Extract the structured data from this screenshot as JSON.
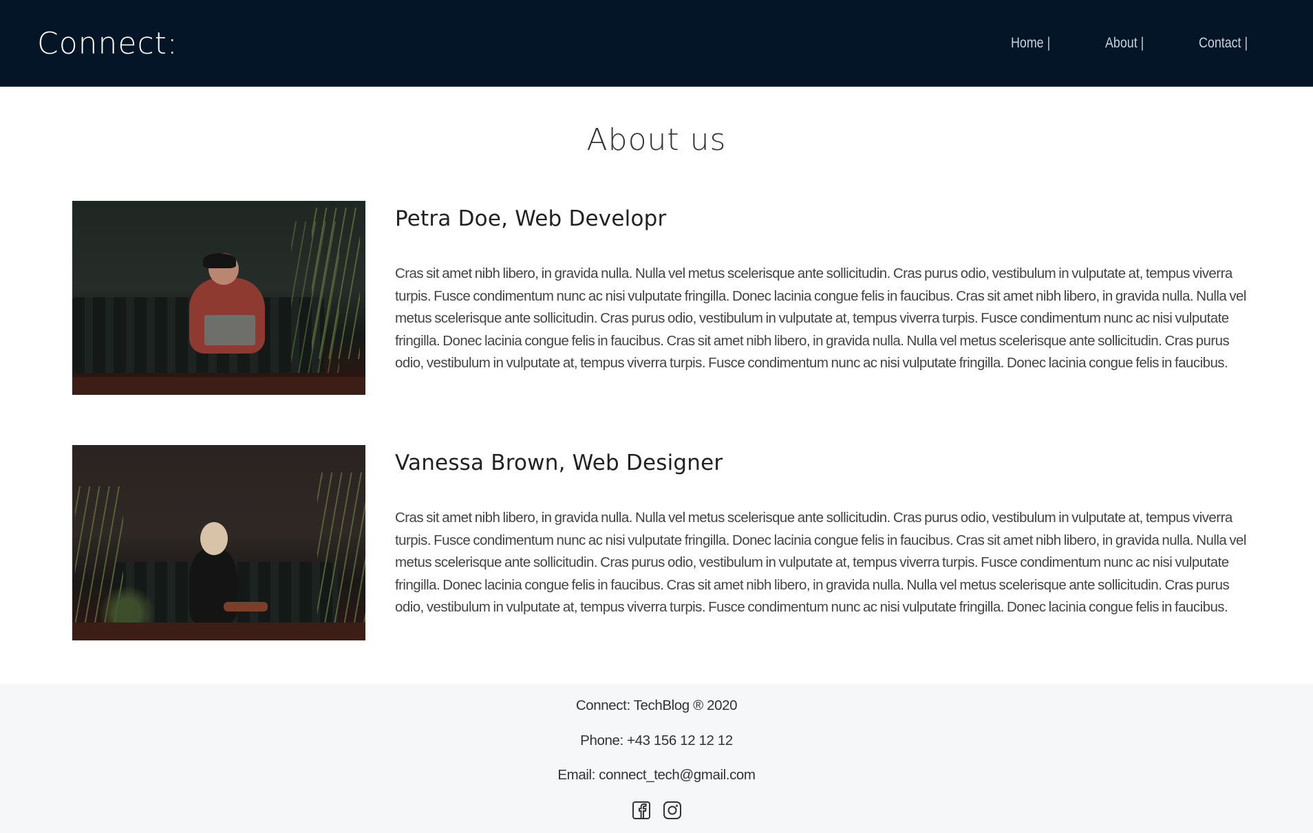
{
  "header": {
    "brand": "Connect:",
    "nav": [
      "Home |",
      "About |",
      "Contact |"
    ]
  },
  "main": {
    "title": "About us",
    "members": [
      {
        "name": "Petra Doe, Web Developr",
        "bio": "Cras sit amet nibh libero, in gravida nulla. Nulla vel metus scelerisque ante sollicitudin. Cras purus odio, vestibulum in vulputate at, tempus viverra turpis. Fusce condimentum nunc ac nisi vulputate fringilla. Donec lacinia congue felis in faucibus. Cras sit amet nibh libero, in gravida nulla. Nulla vel metus scelerisque ante sollicitudin. Cras purus odio, vestibulum in vulputate at, tempus viverra turpis. Fusce condimentum nunc ac nisi vulputate fringilla. Donec lacinia congue felis in faucibus. Cras sit amet nibh libero, in gravida nulla. Nulla vel metus scelerisque ante sollicitudin. Cras purus odio, vestibulum in vulputate at, tempus viverra turpis. Fusce condimentum nunc ac nisi vulputate fringilla. Donec lacinia congue felis in faucibus."
      },
      {
        "name": "Vanessa Brown, Web Designer",
        "bio": "Cras sit amet nibh libero, in gravida nulla. Nulla vel metus scelerisque ante sollicitudin. Cras purus odio, vestibulum in vulputate at, tempus viverra turpis. Fusce condimentum nunc ac nisi vulputate fringilla. Donec lacinia congue felis in faucibus. Cras sit amet nibh libero, in gravida nulla. Nulla vel metus scelerisque ante sollicitudin. Cras purus odio, vestibulum in vulputate at, tempus viverra turpis. Fusce condimentum nunc ac nisi vulputate fringilla. Donec lacinia congue felis in faucibus. Cras sit amet nibh libero, in gravida nulla. Nulla vel metus scelerisque ante sollicitudin. Cras purus odio, vestibulum in vulputate at, tempus viverra turpis. Fusce condimentum nunc ac nisi vulputate fringilla. Donec lacinia congue felis in faucibus."
      }
    ]
  },
  "footer": {
    "copyright": "Connect: TechBlog ® 2020",
    "phone": "Phone: +43 156 12 12 12",
    "email": "Email: connect_tech@gmail.com",
    "social_icons": [
      "facebook-icon",
      "instagram-icon"
    ]
  },
  "colors": {
    "navbar_bg": "#031526",
    "footer_bg": "#f6f7f9"
  }
}
